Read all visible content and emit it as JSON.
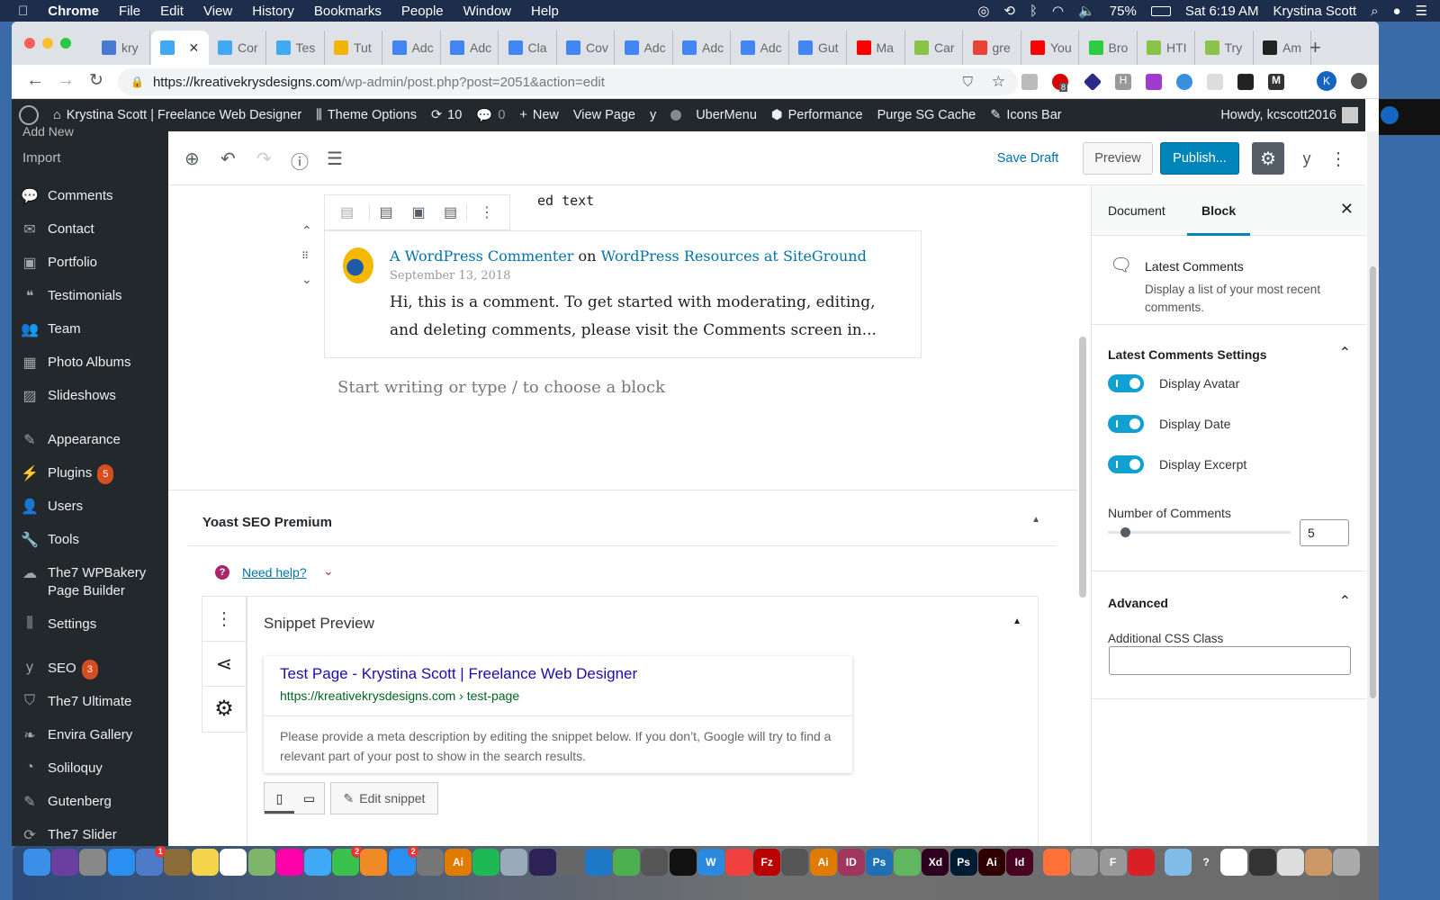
{
  "menubar": {
    "app": "Chrome",
    "items": [
      "File",
      "Edit",
      "View",
      "History",
      "Bookmarks",
      "People",
      "Window",
      "Help"
    ],
    "battery": "75%",
    "clock": "Sat 6:19 AM",
    "user": "Krystina Scott"
  },
  "tabs": [
    {
      "label": "kry",
      "color": "#4a78d6"
    },
    {
      "label": "",
      "color": "#3fa9f5",
      "active": true
    },
    {
      "label": "Cor",
      "color": "#3fa9f5"
    },
    {
      "label": "Tes",
      "color": "#3fa9f5"
    },
    {
      "label": "Tut",
      "color": "#f4b400"
    },
    {
      "label": "Adc",
      "color": "#4285f4"
    },
    {
      "label": "Adc",
      "color": "#4285f4"
    },
    {
      "label": "Cla",
      "color": "#4285f4"
    },
    {
      "label": "Cov",
      "color": "#4285f4"
    },
    {
      "label": "Adc",
      "color": "#4285f4"
    },
    {
      "label": "Adc",
      "color": "#4285f4"
    },
    {
      "label": "Adc",
      "color": "#4285f4"
    },
    {
      "label": "Gut",
      "color": "#4285f4"
    },
    {
      "label": "Ma",
      "color": "#ff0000"
    },
    {
      "label": "Car",
      "color": "#8bc34a"
    },
    {
      "label": "gre",
      "color": "#ea4335"
    },
    {
      "label": "You",
      "color": "#ff0000"
    },
    {
      "label": "Bro",
      "color": "#2ecc40"
    },
    {
      "label": "HTI",
      "color": "#8bc34a"
    },
    {
      "label": "Try",
      "color": "#8bc34a"
    },
    {
      "label": "Am",
      "color": "#222222"
    }
  ],
  "address": {
    "host": "https://kreativekrysdesigns.com",
    "path": "/wp-admin/post.php?post=2051&action=edit",
    "ext_badge": "8",
    "profile": "K"
  },
  "adminbar": {
    "site": "Krystina Scott | Freelance Web Designer",
    "theme_options": "Theme Options",
    "updates": "10",
    "comments": "0",
    "new": "New",
    "view": "View Page",
    "ubermenu": "UberMenu",
    "performance": "Performance",
    "purge": "Purge SG Cache",
    "icons_bar": "Icons Bar",
    "howdy": "Howdy, kcscott2016"
  },
  "sidebar": {
    "partial": "Add New",
    "items": [
      {
        "label": "Import",
        "sub": true
      },
      {
        "label": "Comments",
        "icon": "comment-icon"
      },
      {
        "label": "Contact",
        "icon": "mail-icon"
      },
      {
        "label": "Portfolio",
        "icon": "briefcase-icon"
      },
      {
        "label": "Testimonials",
        "icon": "quote-icon"
      },
      {
        "label": "Team",
        "icon": "team-icon"
      },
      {
        "label": "Photo Albums",
        "icon": "album-icon"
      },
      {
        "label": "Slideshows",
        "icon": "image-icon"
      },
      {
        "label": "Appearance",
        "icon": "brush-icon"
      },
      {
        "label": "Plugins",
        "icon": "plug-icon",
        "badge": "5"
      },
      {
        "label": "Users",
        "icon": "user-icon"
      },
      {
        "label": "Tools",
        "icon": "wrench-icon"
      },
      {
        "label": "The7 WPBakery Page Builder",
        "icon": "cloud-icon"
      },
      {
        "label": "Settings",
        "icon": "sliders-icon"
      },
      {
        "label": "SEO",
        "icon": "yoast-icon",
        "badge": "3"
      },
      {
        "label": "The7 Ultimate",
        "icon": "shield-icon"
      },
      {
        "label": "Envira Gallery",
        "icon": "leaf-icon"
      },
      {
        "label": "Soliloquy",
        "icon": "circle-icon"
      },
      {
        "label": "Gutenberg",
        "icon": "pencil-icon"
      },
      {
        "label": "The7 Slider",
        "icon": "refresh-icon"
      }
    ]
  },
  "toolbar": {
    "save_draft": "Save Draft",
    "preview": "Preview",
    "publish": "Publish..."
  },
  "block": {
    "partial_text": "ed text",
    "author": "A WordPress Commenter",
    "on": "on",
    "post": "WordPress Resources at SiteGround",
    "date": "September 13, 2018",
    "excerpt": "Hi, this is a comment. To get started with moderating, editing, and deleting comments, please visit the Comments screen in...",
    "placeholder": "Start writing or type / to choose a block"
  },
  "yoast": {
    "title": "Yoast SEO Premium",
    "help": "Need help?",
    "snippet_preview": "Snippet Preview",
    "snippet_title": "Test Page - Krystina Scott | Freelance Web Designer",
    "snippet_url": "https://kreativekrysdesigns.com › test-page",
    "snippet_desc": "Please provide a meta description by editing the snippet below. If you don’t, Google will try to find a relevant part of your post to show in the search results.",
    "edit_snippet": "Edit snippet"
  },
  "panel": {
    "tab_document": "Document",
    "tab_block": "Block",
    "block_name": "Latest Comments",
    "block_desc": "Display a list of your most recent comments.",
    "settings_title": "Latest Comments Settings",
    "toggles": [
      {
        "label": "Display Avatar",
        "on": true
      },
      {
        "label": "Display Date",
        "on": true
      },
      {
        "label": "Display Excerpt",
        "on": true
      }
    ],
    "number_label": "Number of Comments",
    "number_value": "5",
    "number_range": [
      1,
      100
    ],
    "advanced": "Advanced",
    "css_label": "Additional CSS Class",
    "css_value": ""
  },
  "dock": {
    "apps": [
      {
        "name": "Finder",
        "c": "#3b8fe8",
        "t": ""
      },
      {
        "name": "Siri",
        "c": "#6b3fa0",
        "t": ""
      },
      {
        "name": "Launchpad",
        "c": "#888",
        "t": ""
      },
      {
        "name": "Safari",
        "c": "#2a8ff0",
        "t": ""
      },
      {
        "name": "Mail",
        "c": "#4e7bc9",
        "t": "",
        "b": "1"
      },
      {
        "name": "Notefile",
        "c": "#8b6b3a",
        "t": ""
      },
      {
        "name": "Notes",
        "c": "#f5d34a",
        "t": ""
      },
      {
        "name": "Reminders",
        "c": "#fff",
        "t": ""
      },
      {
        "name": "Maps",
        "c": "#7fb56a",
        "t": ""
      },
      {
        "name": "Photos",
        "c": "#f0a",
        "t": ""
      },
      {
        "name": "Messages",
        "c": "#3fa9f5",
        "t": ""
      },
      {
        "name": "FaceTime",
        "c": "#3bc24e",
        "t": "",
        "b": "2"
      },
      {
        "name": "Books",
        "c": "#f08a24",
        "t": ""
      },
      {
        "name": "App Store",
        "c": "#2a8ff0",
        "t": "",
        "b": "2"
      },
      {
        "name": "System Preferences",
        "c": "#777",
        "t": ""
      },
      {
        "name": "Illustrator",
        "c": "#e07b00",
        "t": "Ai"
      },
      {
        "name": "Spotify",
        "c": "#1db954",
        "t": ""
      },
      {
        "name": "Disk",
        "c": "#9ab",
        "t": ""
      },
      {
        "name": "Eclipse",
        "c": "#2c2255",
        "t": ""
      },
      {
        "name": "Sequel",
        "c": "#666",
        "t": ""
      },
      {
        "name": "Brackets",
        "c": "#1d78c8",
        "t": ""
      },
      {
        "name": "Chrome",
        "c": "#4caf50",
        "t": ""
      },
      {
        "name": "Script",
        "c": "#555",
        "t": ""
      },
      {
        "name": "Terminal",
        "c": "#111",
        "t": ""
      },
      {
        "name": "Word",
        "c": "#2b8ae0",
        "t": "W"
      },
      {
        "name": "News",
        "c": "#f04040",
        "t": ""
      },
      {
        "name": "FileZilla",
        "c": "#b00",
        "t": "Fz"
      },
      {
        "name": "Photo Booth",
        "c": "#555",
        "t": ""
      },
      {
        "name": "Illustrator 2",
        "c": "#e07b00",
        "t": "Ai"
      },
      {
        "name": "InDesign",
        "c": "#a0365e",
        "t": "ID"
      },
      {
        "name": "Photoshop",
        "c": "#1e6fb4",
        "t": "Ps"
      },
      {
        "name": "Atom",
        "c": "#5fb85f",
        "t": ""
      },
      {
        "name": "XD",
        "c": "#2e001f",
        "t": "Xd"
      },
      {
        "name": "Photoshop CC",
        "c": "#001d34",
        "t": "Ps"
      },
      {
        "name": "Illustrator CC",
        "c": "#310000",
        "t": "Ai"
      },
      {
        "name": "InDesign CC",
        "c": "#49021f",
        "t": "Id"
      },
      {
        "name": "Firefox",
        "c": "#ff7139",
        "t": ""
      },
      {
        "name": "Sequel Pro",
        "c": "#999",
        "t": ""
      },
      {
        "name": "Font",
        "c": "#999",
        "t": "F"
      },
      {
        "name": "Creative Cloud",
        "c": "#da1f26",
        "t": ""
      },
      {
        "name": "Folder",
        "c": "#7fbde8",
        "t": ""
      },
      {
        "name": "Help",
        "c": "transparent",
        "t": "?"
      },
      {
        "name": "Doc",
        "c": "#fff",
        "t": ""
      },
      {
        "name": "Window",
        "c": "#333",
        "t": ""
      },
      {
        "name": "Window 2",
        "c": "#ddd",
        "t": ""
      },
      {
        "name": "Window 3",
        "c": "#c96",
        "t": ""
      },
      {
        "name": "Trash",
        "c": "#aaa",
        "t": ""
      }
    ]
  },
  "colors": {
    "wp_blue": "#0073aa",
    "publish": "#0085ba",
    "toggle": "#11a0d2",
    "admin_bar": "#23282d"
  }
}
